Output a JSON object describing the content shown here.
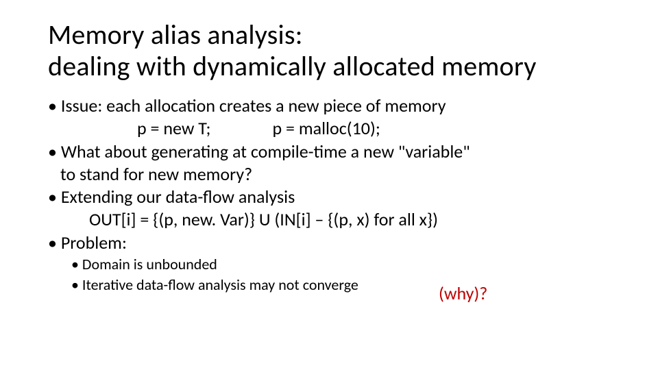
{
  "title_line1": "Memory alias analysis:",
  "title_line2": "dealing with dynamically allocated memory",
  "bullets": {
    "b1": "• Issue: each allocation creates a new piece of memory",
    "ex1": "p = new T;",
    "ex2": "p = malloc(10);",
    "b2a": "• What about generating at compile-time a new \"variable\"",
    "b2b": "to stand for new memory?",
    "b3": "• Extending our data-flow analysis",
    "eq": "OUT[i] = {(p, new. Var)} U (IN[i] – {(p, x) for all x})",
    "b4": "• Problem:",
    "s1": "• Domain is unbounded",
    "s2": "• Iterative data-flow analysis may not converge"
  },
  "why": "(why)?"
}
